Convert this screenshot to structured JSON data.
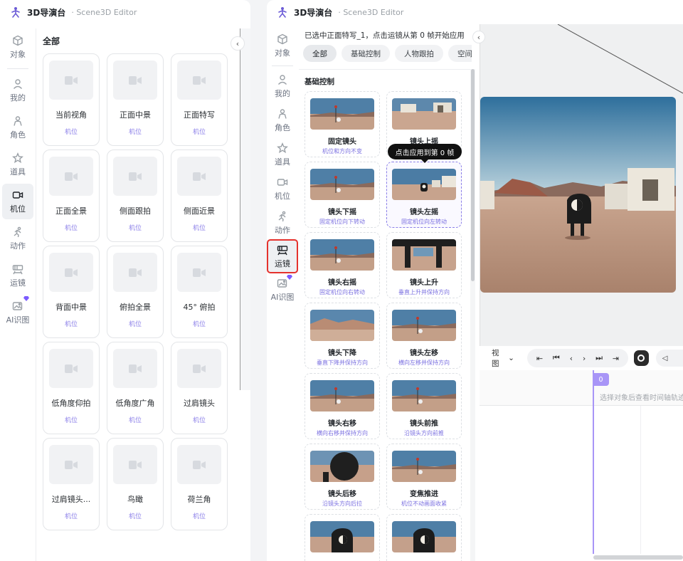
{
  "app": {
    "title": "3D导演台",
    "subtitle": "Scene3D Editor"
  },
  "left_rail": [
    {
      "id": "object",
      "label": "对象",
      "icon": "cube-icon"
    },
    {
      "id": "mine",
      "label": "我的",
      "icon": "user-icon"
    },
    {
      "id": "character",
      "label": "角色",
      "icon": "person-icon"
    },
    {
      "id": "props",
      "label": "道具",
      "icon": "star-icon"
    },
    {
      "id": "camera",
      "label": "机位",
      "icon": "camera-icon",
      "active": true
    },
    {
      "id": "action",
      "label": "动作",
      "icon": "run-icon"
    },
    {
      "id": "movement",
      "label": "运镜",
      "icon": "film-icon"
    },
    {
      "id": "ai",
      "label": "AI识图",
      "icon": "image-scan-icon"
    }
  ],
  "left_panel": {
    "section_title": "全部",
    "collapse_glyph": "‹",
    "cards": [
      {
        "name": "当前视角",
        "tag": "机位"
      },
      {
        "name": "正面中景",
        "tag": "机位"
      },
      {
        "name": "正面特写",
        "tag": "机位"
      },
      {
        "name": "正面全景",
        "tag": "机位"
      },
      {
        "name": "侧面跟拍",
        "tag": "机位"
      },
      {
        "name": "侧面近景",
        "tag": "机位"
      },
      {
        "name": "背面中景",
        "tag": "机位"
      },
      {
        "name": "俯拍全景",
        "tag": "机位"
      },
      {
        "name": "45° 俯拍",
        "tag": "机位"
      },
      {
        "name": "低角度仰拍",
        "tag": "机位"
      },
      {
        "name": "低角度广角",
        "tag": "机位"
      },
      {
        "name": "过肩镜头",
        "tag": "机位"
      },
      {
        "name": "过肩镜头...",
        "tag": "机位"
      },
      {
        "name": "鸟瞰",
        "tag": "机位"
      },
      {
        "name": "荷兰角",
        "tag": "机位"
      }
    ]
  },
  "right_rail": [
    {
      "id": "object",
      "label": "对象",
      "icon": "cube-icon"
    },
    {
      "id": "mine",
      "label": "我的",
      "icon": "user-icon"
    },
    {
      "id": "character",
      "label": "角色",
      "icon": "person-icon"
    },
    {
      "id": "props",
      "label": "道具",
      "icon": "star-icon"
    },
    {
      "id": "camera",
      "label": "机位",
      "icon": "camera-icon"
    },
    {
      "id": "action",
      "label": "动作",
      "icon": "run-icon"
    },
    {
      "id": "movement",
      "label": "运镜",
      "icon": "film-icon",
      "active": true,
      "highlighted": true
    },
    {
      "id": "ai",
      "label": "AI识图",
      "icon": "image-scan-icon"
    }
  ],
  "right_panel": {
    "hint": "已选中正面特写_1，点击运镜从第 0 帧开始应用",
    "tabs": [
      "全部",
      "基础控制",
      "人物跟拍",
      "空间前"
    ],
    "active_tab": 0,
    "section_title": "基础控制",
    "tooltip": "点击应用到第 0 帧",
    "collapse_glyph": "‹",
    "moves": [
      {
        "name": "固定镜头",
        "desc": "机位和方向不变",
        "thumb": "antenna"
      },
      {
        "name": "镜头上摇",
        "desc": "",
        "thumb": "houses"
      },
      {
        "name": "镜头下摇",
        "desc": "固定机位向下转动",
        "thumb": "antenna"
      },
      {
        "name": "镜头左摇",
        "desc": "固定机位向左转动",
        "thumb": "robot",
        "selected": true
      },
      {
        "name": "镜头右摇",
        "desc": "固定机位向右转动",
        "thumb": "antenna"
      },
      {
        "name": "镜头上升",
        "desc": "垂直上升并保持方向",
        "thumb": "pillars"
      },
      {
        "name": "镜头下降",
        "desc": "垂直下降并保持方向",
        "thumb": "desert"
      },
      {
        "name": "镜头左移",
        "desc": "横向左移并保持方向",
        "thumb": "antenna"
      },
      {
        "name": "镜头右移",
        "desc": "横向右移并保持方向",
        "thumb": "antenna"
      },
      {
        "name": "镜头前推",
        "desc": "沿镜头方向前推",
        "thumb": "antenna"
      },
      {
        "name": "镜头后移",
        "desc": "沿镜头方向后拉",
        "thumb": "dark"
      },
      {
        "name": "变焦推进",
        "desc": "机位不动画面收紧",
        "thumb": "antenna"
      },
      {
        "name": "",
        "desc": "",
        "thumb": "bigrobot"
      },
      {
        "name": "",
        "desc": "",
        "thumb": "bigrobot"
      }
    ]
  },
  "toolbar": {
    "view_label": "视图",
    "view_caret": "⌄",
    "transport": [
      "⇤",
      "⏮",
      "‹",
      "›",
      "⏭",
      "⇥"
    ],
    "side_glyph": "◁"
  },
  "timeline": {
    "playhead_frame": "0",
    "empty_message": "选择对象后查看时间轴轨迹"
  },
  "colors": {
    "accent": "#8b7fe8",
    "highlight": "#e5322d",
    "playhead": "#a895f7"
  }
}
